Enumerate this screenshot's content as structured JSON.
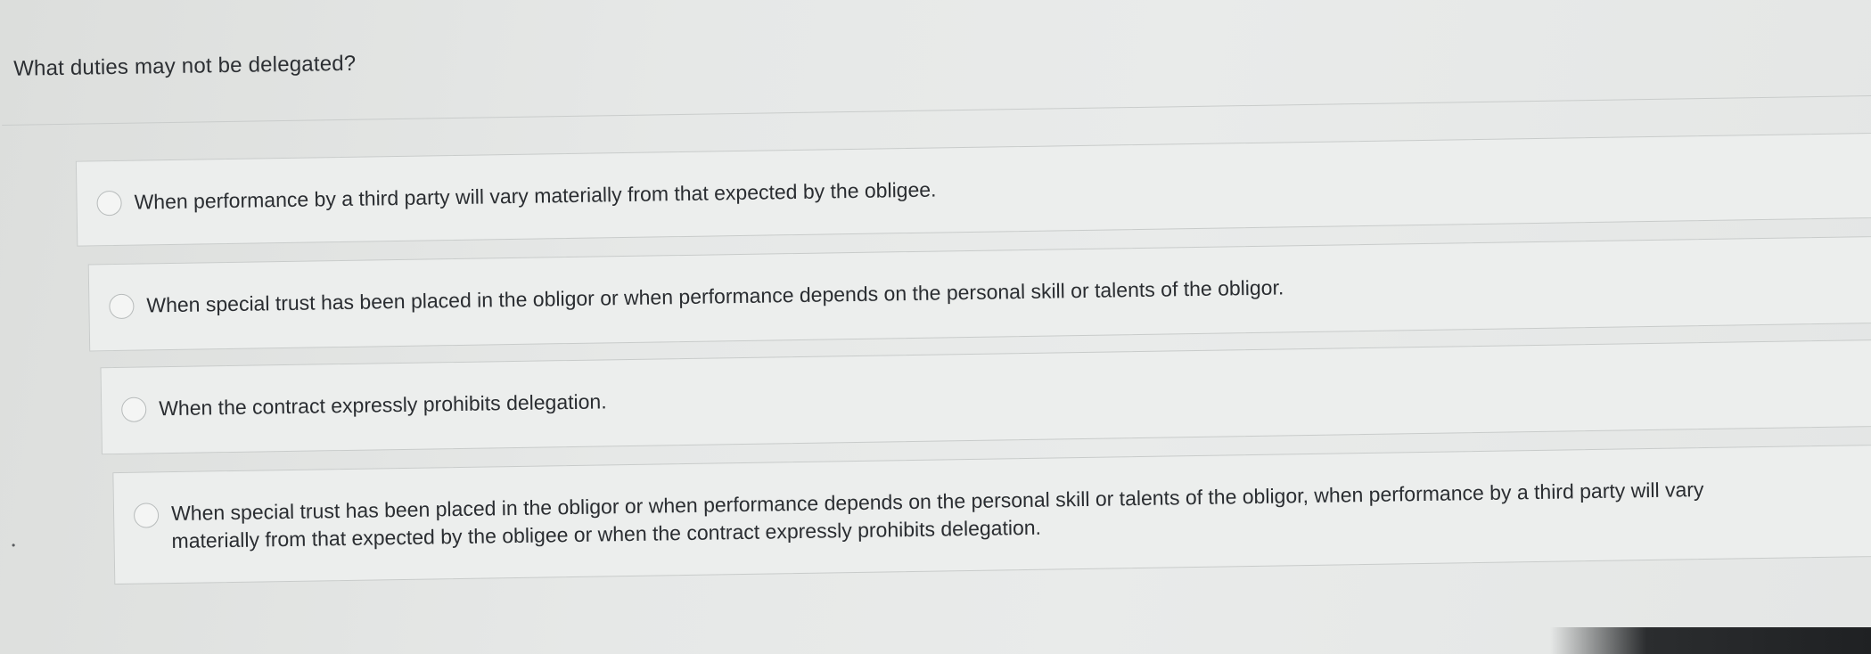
{
  "question": {
    "text": "What duties may not be delegated?"
  },
  "options": [
    {
      "selected": false,
      "label": "When performance by a third party will vary materially from that expected by the obligee."
    },
    {
      "selected": false,
      "label": "When special trust has been placed in the obligor or when performance depends on the personal skill or talents of the obligor."
    },
    {
      "selected": false,
      "label": "When the contract expressly prohibits delegation."
    },
    {
      "selected": false,
      "label": "When special trust has been placed in the obligor or when performance depends on the personal skill or talents of the obligor, when performance by a third party will vary materially from that expected by the obligee or when the contract expressly prohibits delegation."
    }
  ],
  "colors": {
    "background": "#e6e8e7",
    "card_background": "#eceeed",
    "card_border": "#c8cbca",
    "text": "#2a2d31"
  }
}
